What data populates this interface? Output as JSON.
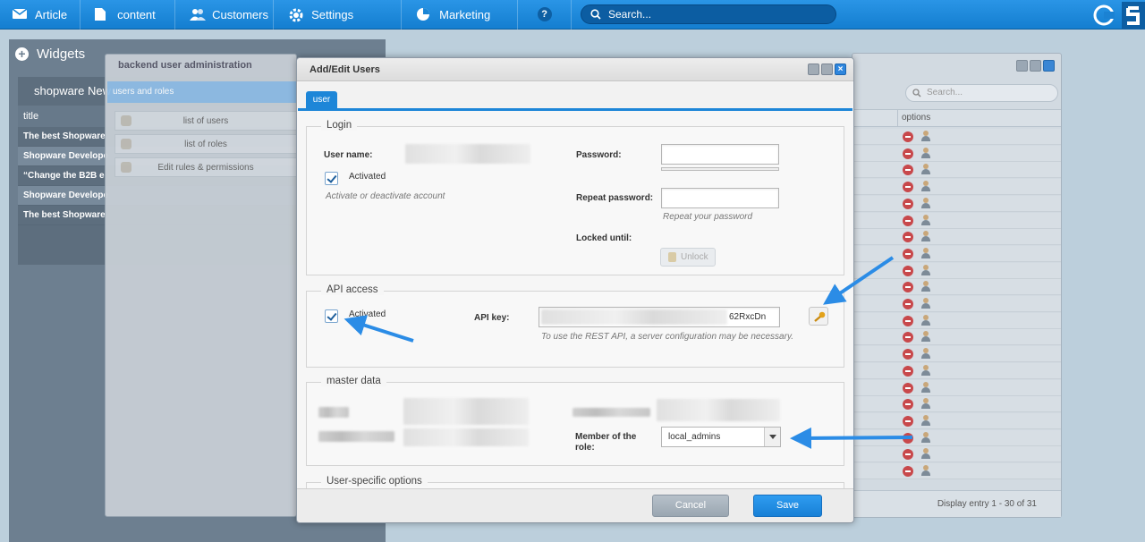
{
  "topbar": {
    "items": [
      {
        "label": "Article",
        "icon": "envelope-icon"
      },
      {
        "label": "content",
        "icon": "document-icon"
      },
      {
        "label": "Customers",
        "icon": "users-icon"
      },
      {
        "label": "Settings",
        "icon": "gear-icon"
      },
      {
        "label": "Marketing",
        "icon": "pie-chart-icon"
      }
    ],
    "help_label": "?",
    "search_placeholder": "Search...",
    "accent": "#1a85d6"
  },
  "widgets": {
    "title": "Widgets",
    "news_title": "shopware New",
    "column_title": "title",
    "rows": [
      "The best Shopware",
      "Shopware Develope",
      "“Change the B2B e",
      "Shopware Develope",
      "The best Shopware"
    ]
  },
  "user_admin": {
    "title": "backend user administration",
    "tab": "users and roles",
    "items": [
      "list of users",
      "list of roles",
      "Edit rules & permissions"
    ]
  },
  "user_list": {
    "search_placeholder": "Search...",
    "options_header": "options",
    "footer": "Display entry 1 - 30 of 31"
  },
  "dialog": {
    "title": "Add/Edit Users",
    "tab": "user",
    "login": {
      "legend": "Login",
      "username_label": "User name:",
      "activated_label": "Activated",
      "activated_hint": "Activate or deactivate account",
      "password_label": "Password:",
      "repeat_label": "Repeat password:",
      "repeat_hint": "Repeat your password",
      "locked_label": "Locked until:",
      "unlock_label": "Unlock"
    },
    "api": {
      "legend": "API access",
      "activated_label": "Activated",
      "key_label": "API key:",
      "key_value_visible": "62RxcDn",
      "hint": "To use the REST API, a server configuration may be necessary."
    },
    "master": {
      "legend": "master data",
      "role_label": "Member of the role:",
      "role_value": "local_admins"
    },
    "user_specific": {
      "legend": "User-specific options"
    },
    "cancel_label": "Cancel",
    "save_label": "Save"
  }
}
